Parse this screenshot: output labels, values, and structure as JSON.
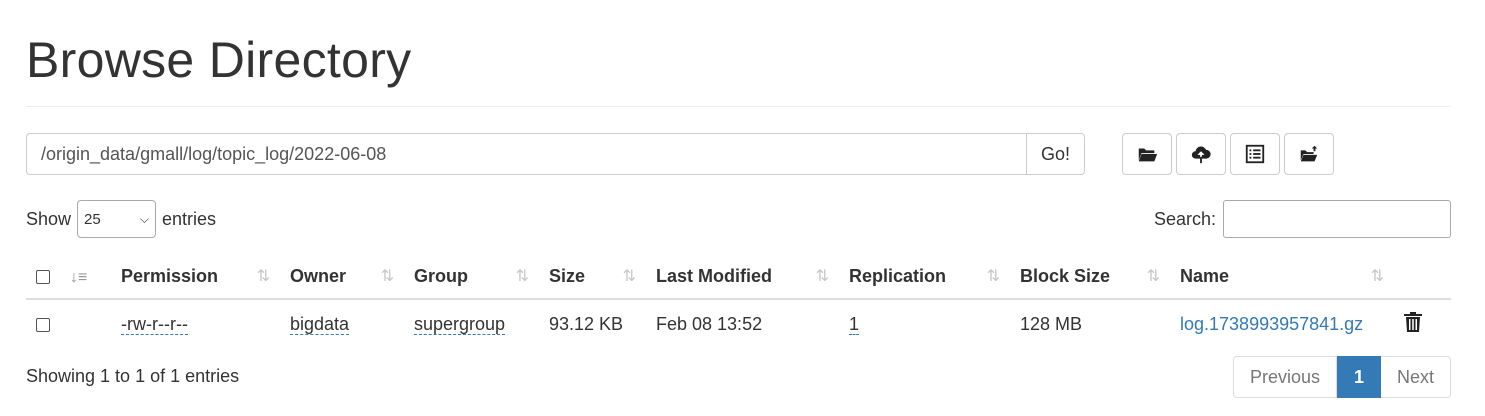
{
  "page": {
    "title": "Browse Directory"
  },
  "path": {
    "value": "/origin_data/gmall/log/topic_log/2022-06-08",
    "go_label": "Go!"
  },
  "toolbar": {
    "icons": [
      "folder-open-icon",
      "cloud-upload-icon",
      "list-alt-icon",
      "folder-move-icon"
    ]
  },
  "length": {
    "show_label": "Show",
    "selected": "25",
    "entries_label": "entries"
  },
  "search": {
    "label": "Search:",
    "value": ""
  },
  "table": {
    "columns": [
      "Permission",
      "Owner",
      "Group",
      "Size",
      "Last Modified",
      "Replication",
      "Block Size",
      "Name"
    ],
    "rows": [
      {
        "permission": "-rw-r--r--",
        "owner": "bigdata",
        "group": "supergroup",
        "size": "93.12 KB",
        "last_modified": "Feb 08 13:52",
        "replication": "1",
        "block_size": "128 MB",
        "name": "log.1738993957841.gz"
      }
    ]
  },
  "footer": {
    "info": "Showing 1 to 1 of 1 entries",
    "previous": "Previous",
    "current_page": "1",
    "next": "Next"
  },
  "colors": {
    "link": "#337ab7",
    "active_page_bg": "#337ab7",
    "rule": "#dddddd"
  }
}
